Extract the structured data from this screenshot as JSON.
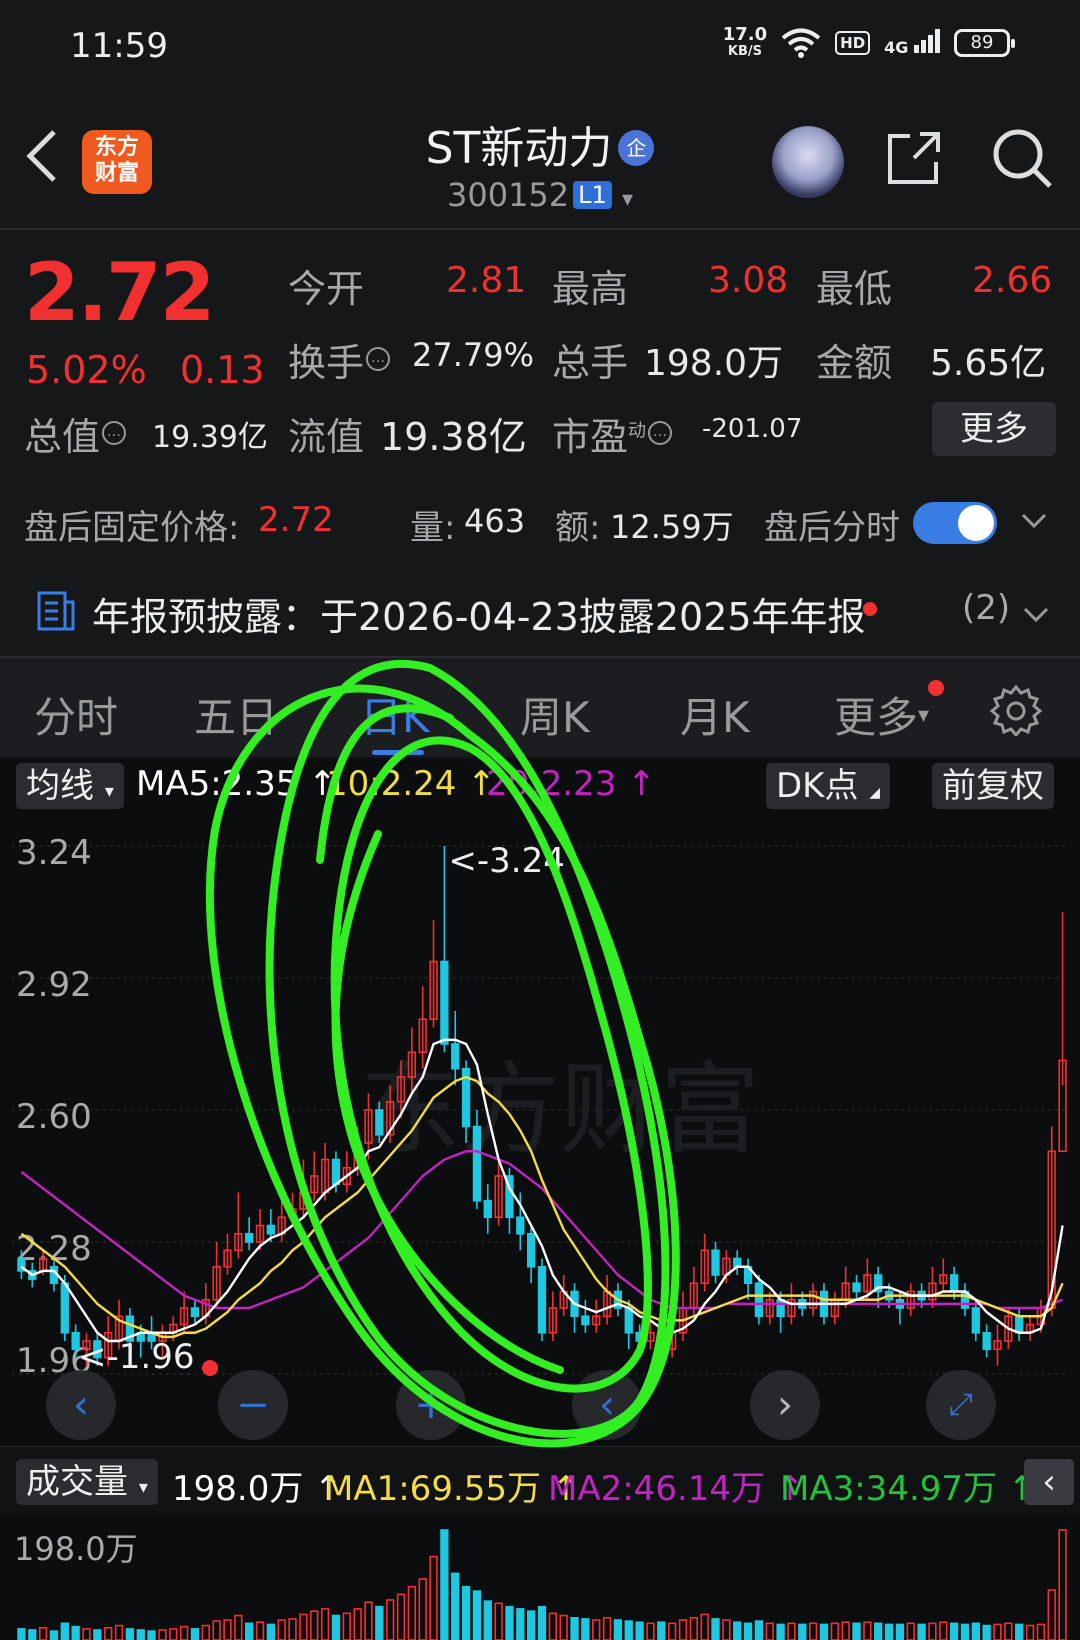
{
  "status_bar": {
    "time": "11:59",
    "net_speed": "17.0",
    "net_unit": "KB/S",
    "hd": "HD",
    "signal": "4G",
    "battery": "89"
  },
  "header": {
    "logo_text_1": "东方",
    "logo_text_2": "财富",
    "stock_name": "ST新动力",
    "name_badge": "企",
    "stock_code": "300152",
    "level": "L1"
  },
  "quote": {
    "price": "2.72",
    "change_pct": "5.02%",
    "change": "0.13",
    "open_label": "今开",
    "open": "2.81",
    "high_label": "最高",
    "high": "3.08",
    "low_label": "最低",
    "low": "2.66",
    "turnover_label": "换手",
    "turnover": "27.79%",
    "volume_label": "总手",
    "volume": "198.0万",
    "amount_label": "金额",
    "amount": "5.65亿",
    "mktcap_label": "总值",
    "mktcap": "19.39亿",
    "float_label": "流值",
    "float_cap": "19.38亿",
    "pe_label": "市盈",
    "pe_sup": "动",
    "pe": "-201.07",
    "more_label": "更多"
  },
  "after_hours": {
    "price_label": "盘后固定价格:",
    "price": "2.72",
    "vol_label": "量:",
    "vol": "463",
    "amt_label": "额:",
    "amt": "12.59万",
    "toggle_label": "盘后分时"
  },
  "notice": {
    "text": "年报预披露：于2026-04-23披露2025年年报",
    "count": "(2)"
  },
  "tabs": [
    {
      "label": "分时",
      "active": false
    },
    {
      "label": "五日",
      "active": false
    },
    {
      "label": "日K",
      "active": true
    },
    {
      "label": "周K",
      "active": false
    },
    {
      "label": "月K",
      "active": false
    },
    {
      "label": "更多",
      "active": false
    }
  ],
  "ma_bar": {
    "indicator": "均线",
    "ma5": "MA5:2.35",
    "ma10": "10:2.24",
    "ma20": "20:2.23",
    "dk": "DK点",
    "adjust": "前复权"
  },
  "volume_bar": {
    "indicator": "成交量",
    "vol": "198.0万",
    "ma1": "MA1:69.55万",
    "ma2": "MA2:46.14万",
    "ma3": "MA3:34.97万",
    "max_label": "198.0万"
  },
  "colors": {
    "up": "#f23030",
    "down": "#1fc7e0",
    "ma5": "#ffffff",
    "ma10": "#f3dc45",
    "ma20": "#c223c2",
    "accent": "#3a7de4",
    "annotation": "#33ee22"
  },
  "chart_data": {
    "type": "candlestick",
    "y_ticks": [
      "3.24",
      "2.92",
      "2.60",
      "2.28",
      "1.96"
    ],
    "ylim": [
      1.96,
      3.24
    ],
    "max_marker": "<-3.24",
    "min_marker": "<-1.96",
    "candles": [
      [
        2.24,
        2.21,
        2.26,
        2.19
      ],
      [
        2.21,
        2.19,
        2.23,
        2.17
      ],
      [
        2.21,
        2.24,
        2.26,
        2.2
      ],
      [
        2.22,
        2.18,
        2.24,
        2.16
      ],
      [
        2.18,
        2.06,
        2.2,
        2.04
      ],
      [
        2.06,
        2.02,
        2.08,
        2.0
      ],
      [
        2.02,
        2.04,
        2.06,
        1.98
      ],
      [
        2.04,
        2.0,
        2.06,
        1.98
      ],
      [
        2.0,
        2.06,
        2.1,
        1.98
      ],
      [
        2.04,
        2.1,
        2.14,
        2.02
      ],
      [
        2.1,
        2.04,
        2.12,
        2.02
      ],
      [
        2.06,
        2.04,
        2.08,
        2.0
      ],
      [
        2.06,
        2.04,
        2.1,
        2.02
      ],
      [
        2.04,
        2.06,
        2.08,
        2.0
      ],
      [
        2.06,
        2.08,
        2.1,
        2.04
      ],
      [
        2.08,
        2.12,
        2.16,
        2.06
      ],
      [
        2.12,
        2.1,
        2.14,
        2.08
      ],
      [
        2.1,
        2.14,
        2.18,
        2.08
      ],
      [
        2.14,
        2.22,
        2.28,
        2.12
      ],
      [
        2.22,
        2.26,
        2.3,
        2.2
      ],
      [
        2.26,
        2.3,
        2.4,
        2.24
      ],
      [
        2.3,
        2.28,
        2.34,
        2.26
      ],
      [
        2.28,
        2.32,
        2.36,
        2.26
      ],
      [
        2.32,
        2.3,
        2.36,
        2.28
      ],
      [
        2.3,
        2.34,
        2.38,
        2.28
      ],
      [
        2.34,
        2.36,
        2.4,
        2.32
      ],
      [
        2.36,
        2.4,
        2.48,
        2.34
      ],
      [
        2.4,
        2.44,
        2.5,
        2.38
      ],
      [
        2.4,
        2.48,
        2.52,
        2.38
      ],
      [
        2.48,
        2.42,
        2.5,
        2.4
      ],
      [
        2.42,
        2.46,
        2.5,
        2.4
      ],
      [
        2.46,
        2.52,
        2.56,
        2.44
      ],
      [
        2.52,
        2.6,
        2.64,
        2.48
      ],
      [
        2.6,
        2.54,
        2.62,
        2.52
      ],
      [
        2.54,
        2.62,
        2.66,
        2.52
      ],
      [
        2.62,
        2.68,
        2.72,
        2.58
      ],
      [
        2.68,
        2.74,
        2.8,
        2.64
      ],
      [
        2.74,
        2.82,
        2.9,
        2.7
      ],
      [
        2.82,
        2.96,
        3.06,
        2.8
      ],
      [
        2.96,
        2.76,
        3.24,
        2.74
      ],
      [
        2.76,
        2.7,
        2.84,
        2.66
      ],
      [
        2.7,
        2.56,
        2.72,
        2.52
      ],
      [
        2.56,
        2.38,
        2.6,
        2.36
      ],
      [
        2.38,
        2.34,
        2.42,
        2.3
      ],
      [
        2.34,
        2.44,
        2.48,
        2.32
      ],
      [
        2.44,
        2.34,
        2.46,
        2.3
      ],
      [
        2.34,
        2.3,
        2.4,
        2.26
      ],
      [
        2.3,
        2.22,
        2.32,
        2.18
      ],
      [
        2.22,
        2.06,
        2.24,
        2.04
      ],
      [
        2.06,
        2.12,
        2.16,
        2.04
      ],
      [
        2.12,
        2.16,
        2.2,
        2.1
      ],
      [
        2.16,
        2.1,
        2.18,
        2.06
      ],
      [
        2.1,
        2.08,
        2.14,
        2.06
      ],
      [
        2.08,
        2.1,
        2.14,
        2.06
      ],
      [
        2.1,
        2.16,
        2.2,
        2.08
      ],
      [
        2.16,
        2.12,
        2.18,
        2.1
      ],
      [
        2.12,
        2.06,
        2.14,
        2.02
      ],
      [
        2.06,
        2.04,
        2.08,
        2.0
      ],
      [
        2.04,
        2.06,
        2.1,
        2.02
      ],
      [
        2.06,
        2.02,
        2.08,
        1.98
      ],
      [
        2.02,
        2.06,
        2.1,
        2.0
      ],
      [
        2.06,
        2.12,
        2.16,
        2.04
      ],
      [
        2.12,
        2.18,
        2.22,
        2.1
      ],
      [
        2.18,
        2.26,
        2.3,
        2.16
      ],
      [
        2.26,
        2.2,
        2.28,
        2.18
      ],
      [
        2.2,
        2.24,
        2.26,
        2.18
      ],
      [
        2.24,
        2.22,
        2.26,
        2.2
      ],
      [
        2.22,
        2.18,
        2.24,
        2.14
      ],
      [
        2.18,
        2.1,
        2.2,
        2.08
      ],
      [
        2.1,
        2.14,
        2.16,
        2.08
      ],
      [
        2.14,
        2.1,
        2.16,
        2.06
      ],
      [
        2.1,
        2.14,
        2.18,
        2.08
      ],
      [
        2.14,
        2.12,
        2.16,
        2.1
      ],
      [
        2.12,
        2.16,
        2.18,
        2.1
      ],
      [
        2.16,
        2.1,
        2.18,
        2.08
      ],
      [
        2.1,
        2.14,
        2.16,
        2.08
      ],
      [
        2.14,
        2.18,
        2.22,
        2.12
      ],
      [
        2.18,
        2.16,
        2.2,
        2.14
      ],
      [
        2.16,
        2.2,
        2.24,
        2.14
      ],
      [
        2.2,
        2.16,
        2.22,
        2.12
      ],
      [
        2.16,
        2.14,
        2.18,
        2.12
      ],
      [
        2.14,
        2.12,
        2.16,
        2.08
      ],
      [
        2.12,
        2.16,
        2.18,
        2.1
      ],
      [
        2.16,
        2.14,
        2.18,
        2.12
      ],
      [
        2.14,
        2.18,
        2.22,
        2.12
      ],
      [
        2.18,
        2.2,
        2.24,
        2.16
      ],
      [
        2.2,
        2.16,
        2.22,
        2.14
      ],
      [
        2.16,
        2.12,
        2.18,
        2.1
      ],
      [
        2.12,
        2.06,
        2.14,
        2.04
      ],
      [
        2.06,
        2.02,
        2.08,
        2.0
      ],
      [
        2.02,
        2.04,
        2.08,
        1.98
      ],
      [
        2.04,
        2.1,
        2.12,
        2.02
      ],
      [
        2.1,
        2.06,
        2.12,
        2.04
      ],
      [
        2.06,
        2.08,
        2.1,
        2.04
      ],
      [
        2.08,
        2.12,
        2.14,
        2.06
      ],
      [
        2.12,
        2.5,
        2.56,
        2.1
      ],
      [
        2.5,
        2.72,
        3.08,
        2.66
      ]
    ],
    "ma5": [
      2.22,
      2.2,
      2.21,
      2.21,
      2.18,
      2.14,
      2.1,
      2.06,
      2.04,
      2.04,
      2.05,
      2.06,
      2.06,
      2.06,
      2.06,
      2.07,
      2.08,
      2.1,
      2.13,
      2.16,
      2.2,
      2.24,
      2.27,
      2.29,
      2.3,
      2.32,
      2.34,
      2.37,
      2.4,
      2.42,
      2.44,
      2.46,
      2.5,
      2.51,
      2.55,
      2.59,
      2.64,
      2.68,
      2.76,
      2.77,
      2.77,
      2.76,
      2.71,
      2.59,
      2.48,
      2.41,
      2.37,
      2.32,
      2.27,
      2.2,
      2.16,
      2.13,
      2.12,
      2.11,
      2.12,
      2.13,
      2.12,
      2.1,
      2.09,
      2.07,
      2.06,
      2.07,
      2.09,
      2.13,
      2.16,
      2.2,
      2.22,
      2.22,
      2.19,
      2.17,
      2.14,
      2.13,
      2.13,
      2.13,
      2.13,
      2.13,
      2.13,
      2.14,
      2.15,
      2.17,
      2.17,
      2.16,
      2.15,
      2.15,
      2.15,
      2.16,
      2.16,
      2.16,
      2.14,
      2.11,
      2.09,
      2.07,
      2.06,
      2.06,
      2.07,
      2.16,
      2.32
    ],
    "ma10": [
      2.3,
      2.28,
      2.26,
      2.24,
      2.22,
      2.19,
      2.16,
      2.13,
      2.11,
      2.09,
      2.08,
      2.07,
      2.06,
      2.05,
      2.05,
      2.06,
      2.06,
      2.07,
      2.09,
      2.11,
      2.14,
      2.16,
      2.18,
      2.21,
      2.23,
      2.26,
      2.28,
      2.31,
      2.34,
      2.36,
      2.38,
      2.4,
      2.43,
      2.46,
      2.49,
      2.52,
      2.55,
      2.59,
      2.63,
      2.65,
      2.67,
      2.68,
      2.67,
      2.64,
      2.62,
      2.59,
      2.55,
      2.5,
      2.43,
      2.37,
      2.31,
      2.27,
      2.23,
      2.19,
      2.16,
      2.14,
      2.13,
      2.11,
      2.1,
      2.09,
      2.09,
      2.09,
      2.1,
      2.11,
      2.12,
      2.13,
      2.14,
      2.15,
      2.15,
      2.15,
      2.15,
      2.15,
      2.15,
      2.15,
      2.14,
      2.14,
      2.14,
      2.14,
      2.14,
      2.14,
      2.15,
      2.15,
      2.15,
      2.15,
      2.15,
      2.15,
      2.15,
      2.15,
      2.14,
      2.13,
      2.12,
      2.11,
      2.1,
      2.1,
      2.1,
      2.12,
      2.18
    ],
    "ma20": [
      2.45,
      2.43,
      2.41,
      2.39,
      2.37,
      2.35,
      2.33,
      2.31,
      2.29,
      2.27,
      2.25,
      2.23,
      2.21,
      2.19,
      2.17,
      2.15,
      2.14,
      2.13,
      2.12,
      2.12,
      2.12,
      2.12,
      2.13,
      2.14,
      2.15,
      2.16,
      2.17,
      2.19,
      2.21,
      2.23,
      2.25,
      2.27,
      2.29,
      2.32,
      2.35,
      2.38,
      2.41,
      2.44,
      2.46,
      2.48,
      2.49,
      2.5,
      2.5,
      2.49,
      2.48,
      2.47,
      2.45,
      2.43,
      2.41,
      2.38,
      2.35,
      2.32,
      2.29,
      2.26,
      2.23,
      2.2,
      2.18,
      2.16,
      2.14,
      2.13,
      2.12,
      2.12,
      2.12,
      2.12,
      2.12,
      2.13,
      2.13,
      2.13,
      2.13,
      2.13,
      2.13,
      2.13,
      2.13,
      2.13,
      2.13,
      2.13,
      2.13,
      2.13,
      2.13,
      2.13,
      2.13,
      2.13,
      2.13,
      2.13,
      2.13,
      2.13,
      2.13,
      2.13,
      2.13,
      2.13,
      2.12,
      2.12,
      2.12,
      2.12,
      2.12,
      2.13,
      2.14
    ],
    "volume": [
      20,
      18,
      22,
      16,
      30,
      24,
      20,
      18,
      22,
      26,
      20,
      18,
      16,
      18,
      20,
      24,
      20,
      26,
      34,
      36,
      44,
      30,
      32,
      28,
      36,
      38,
      46,
      52,
      56,
      44,
      48,
      56,
      68,
      60,
      72,
      82,
      96,
      110,
      150,
      198,
      120,
      96,
      88,
      70,
      66,
      60,
      56,
      52,
      60,
      48,
      44,
      40,
      38,
      36,
      40,
      36,
      34,
      32,
      30,
      32,
      30,
      36,
      40,
      46,
      38,
      36,
      32,
      30,
      34,
      30,
      28,
      30,
      28,
      30,
      28,
      30,
      32,
      30,
      32,
      30,
      28,
      28,
      30,
      28,
      30,
      32,
      30,
      28,
      30,
      26,
      28,
      30,
      28,
      26,
      28,
      90,
      198
    ]
  }
}
